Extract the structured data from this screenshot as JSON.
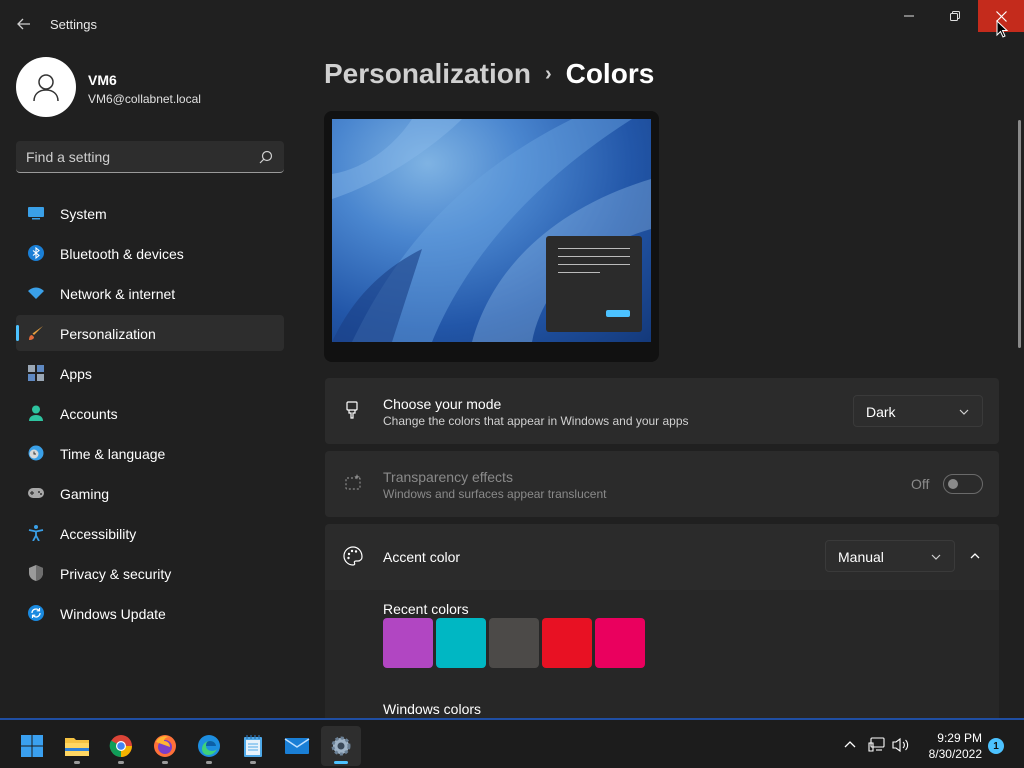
{
  "window": {
    "title": "Settings",
    "back_icon": "back-arrow-icon",
    "minimize_icon": "minimize-icon",
    "maximize_icon": "restore-icon",
    "close_icon": "close-icon",
    "close_color": "#c42b1c"
  },
  "profile": {
    "name": "VM6",
    "email": "VM6@collabnet.local",
    "avatar_icon": "user-avatar-icon"
  },
  "search": {
    "placeholder": "Find a setting",
    "icon": "search-icon"
  },
  "sidebar": {
    "items": [
      {
        "label": "System",
        "icon": "monitor-icon",
        "active": false
      },
      {
        "label": "Bluetooth & devices",
        "icon": "bluetooth-icon",
        "active": false
      },
      {
        "label": "Network & internet",
        "icon": "wifi-icon",
        "active": false
      },
      {
        "label": "Personalization",
        "icon": "paintbrush-icon",
        "active": true
      },
      {
        "label": "Apps",
        "icon": "apps-icon",
        "active": false
      },
      {
        "label": "Accounts",
        "icon": "person-icon",
        "active": false
      },
      {
        "label": "Time & language",
        "icon": "clock-globe-icon",
        "active": false
      },
      {
        "label": "Gaming",
        "icon": "gamepad-icon",
        "active": false
      },
      {
        "label": "Accessibility",
        "icon": "accessibility-icon",
        "active": false
      },
      {
        "label": "Privacy & security",
        "icon": "shield-icon",
        "active": false
      },
      {
        "label": "Windows Update",
        "icon": "update-icon",
        "active": false
      }
    ]
  },
  "breadcrumb": {
    "parent": "Personalization",
    "separator": "›",
    "current": "Colors"
  },
  "cards": {
    "mode": {
      "title": "Choose your mode",
      "subtitle": "Change the colors that appear in Windows and your apps",
      "icon": "paint-bucket-icon",
      "value": "Dark"
    },
    "transparency": {
      "title": "Transparency effects",
      "subtitle": "Windows and surfaces appear translucent",
      "icon": "transparency-icon",
      "state_label": "Off",
      "enabled": false
    },
    "accent": {
      "title": "Accent color",
      "icon": "palette-icon",
      "value": "Manual",
      "expanded": true
    }
  },
  "recent_colors": {
    "label": "Recent colors",
    "colors": [
      "#b146c2",
      "#00b7c3",
      "#4c4a48",
      "#e81123",
      "#ea005e"
    ]
  },
  "windows_colors": {
    "label": "Windows colors"
  },
  "taskbar": {
    "apps": [
      {
        "name": "start-icon",
        "active": false
      },
      {
        "name": "file-explorer-icon",
        "active": false
      },
      {
        "name": "chrome-icon",
        "active": false
      },
      {
        "name": "firefox-icon",
        "active": false
      },
      {
        "name": "edge-icon",
        "active": false
      },
      {
        "name": "notepad-icon",
        "active": false
      },
      {
        "name": "mail-icon",
        "active": false
      },
      {
        "name": "settings-gear-icon",
        "active": true
      }
    ],
    "time": "9:29 PM",
    "date": "8/30/2022",
    "notification_count": "1"
  },
  "colors": {
    "accent": "#4cc2ff",
    "background": "#202020",
    "card": "#2b2b2b"
  }
}
